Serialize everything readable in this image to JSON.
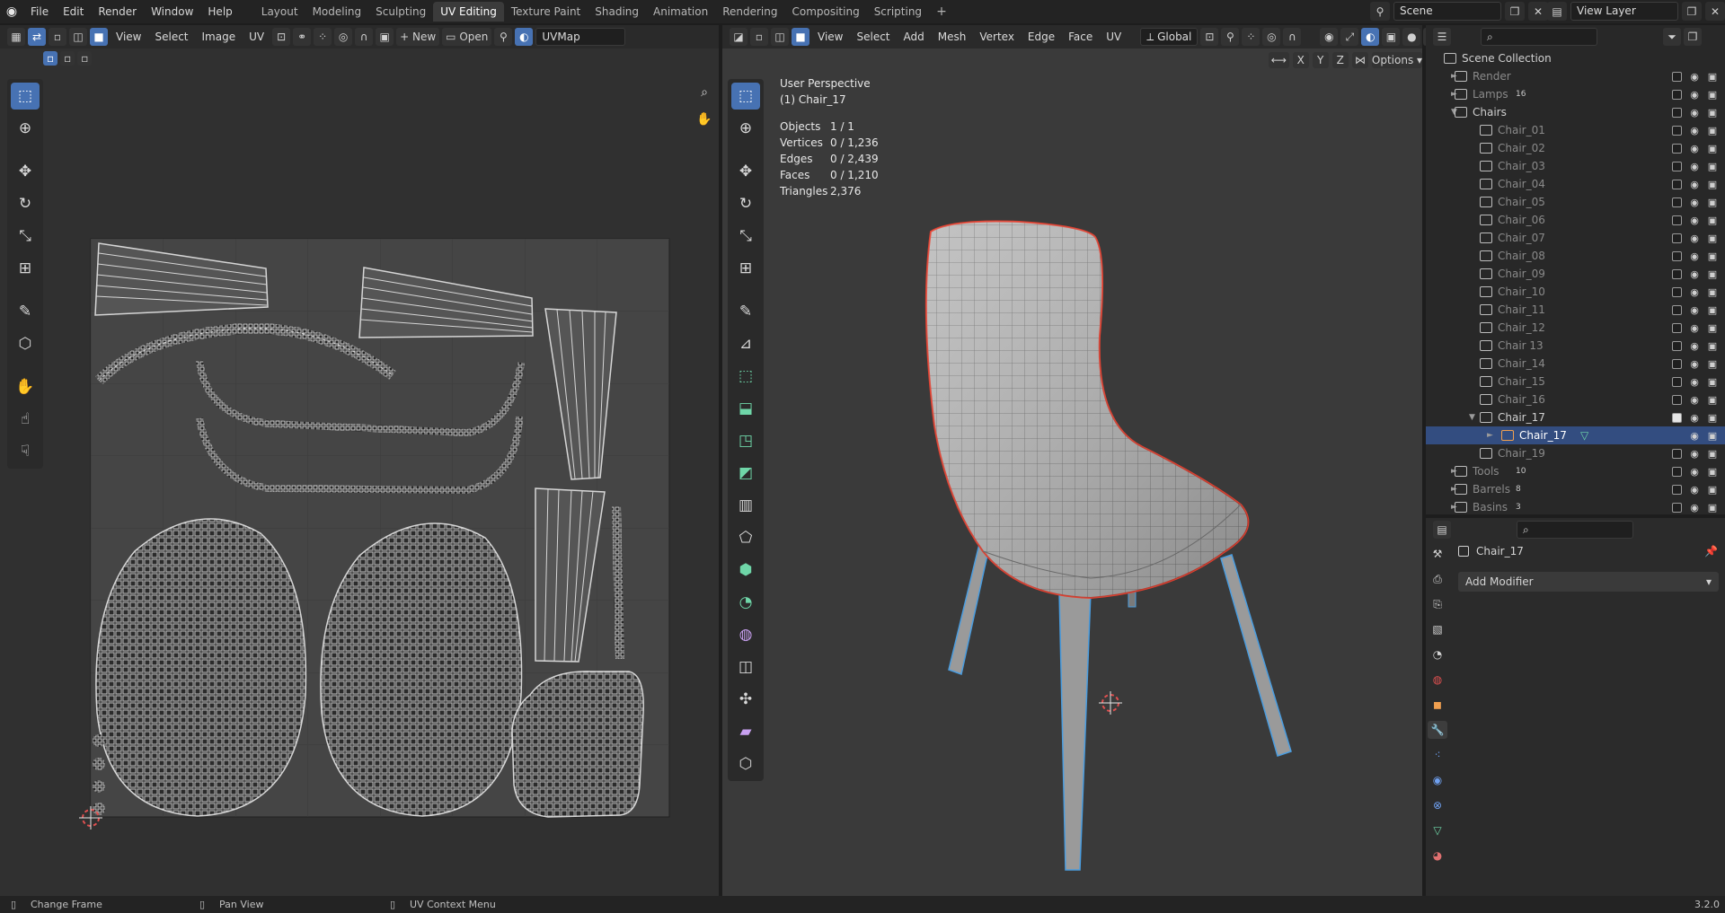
{
  "topbar": {
    "menus": [
      "File",
      "Edit",
      "Render",
      "Window",
      "Help"
    ],
    "workspaces": [
      "Layout",
      "Modeling",
      "Sculpting",
      "UV Editing",
      "Texture Paint",
      "Shading",
      "Animation",
      "Rendering",
      "Compositing",
      "Scripting"
    ],
    "active_workspace": "UV Editing",
    "add_workspace": "+",
    "scene": "Scene",
    "view_layer": "View Layer"
  },
  "uv_editor": {
    "header": {
      "menus": [
        "View",
        "Select",
        "Image",
        "UV"
      ],
      "new_label": "New",
      "open_label": "Open",
      "uvmap": "UVMap"
    }
  },
  "viewport": {
    "header": {
      "menus": [
        "View",
        "Select",
        "Add",
        "Mesh",
        "Vertex",
        "Edge",
        "Face",
        "UV"
      ],
      "orientation": "Global",
      "options_label": "Options",
      "axes": [
        "X",
        "Y",
        "Z"
      ]
    },
    "view_name": "User Perspective",
    "object_name": "(1) Chair_17",
    "stats": [
      {
        "label": "Objects",
        "value": "1 / 1"
      },
      {
        "label": "Vertices",
        "value": "0 / 1,236"
      },
      {
        "label": "Edges",
        "value": "0 / 2,439"
      },
      {
        "label": "Faces",
        "value": "0 / 1,210"
      },
      {
        "label": "Triangles",
        "value": "2,376"
      }
    ]
  },
  "outliner": {
    "root": "Scene Collection",
    "rows": [
      {
        "label": "Render",
        "type": "collection",
        "badge": ""
      },
      {
        "label": "Lamps",
        "type": "collection",
        "badge": "16"
      },
      {
        "label": "Chairs",
        "type": "collection",
        "badge": ""
      },
      {
        "label": "Chair_01",
        "type": "chair"
      },
      {
        "label": "Chair_02",
        "type": "chair"
      },
      {
        "label": "Chair_03",
        "type": "chair"
      },
      {
        "label": "Chair_04",
        "type": "chair"
      },
      {
        "label": "Chair_05",
        "type": "chair"
      },
      {
        "label": "Chair_06",
        "type": "chair"
      },
      {
        "label": "Chair_07",
        "type": "chair"
      },
      {
        "label": "Chair_08",
        "type": "chair"
      },
      {
        "label": "Chair_09",
        "type": "chair"
      },
      {
        "label": "Chair_10",
        "type": "chair"
      },
      {
        "label": "Chair_11",
        "type": "chair"
      },
      {
        "label": "Chair_12",
        "type": "chair"
      },
      {
        "label": "Chair 13",
        "type": "chair"
      },
      {
        "label": "Chair_14",
        "type": "chair"
      },
      {
        "label": "Chair_15",
        "type": "chair"
      },
      {
        "label": "Chair_16",
        "type": "chair"
      },
      {
        "label": "Chair_17",
        "type": "chair-open"
      },
      {
        "label": "Chair_17",
        "type": "mesh-selected"
      },
      {
        "label": "Chair_19",
        "type": "chair"
      },
      {
        "label": "Tools",
        "type": "collection",
        "badge": "10"
      },
      {
        "label": "Barrels",
        "type": "collection",
        "badge": "8"
      },
      {
        "label": "Basins",
        "type": "collection",
        "badge": "3"
      }
    ]
  },
  "properties": {
    "object_name": "Chair_17",
    "add_modifier": "Add Modifier"
  },
  "statusbar": {
    "left": "Change Frame",
    "middle": "Pan View",
    "right": "UV Context Menu",
    "version": "3.2.0"
  },
  "colors": {
    "accent": "#4772b3",
    "selection_outline": "#e04030",
    "edge_select": "#4a9de0"
  }
}
